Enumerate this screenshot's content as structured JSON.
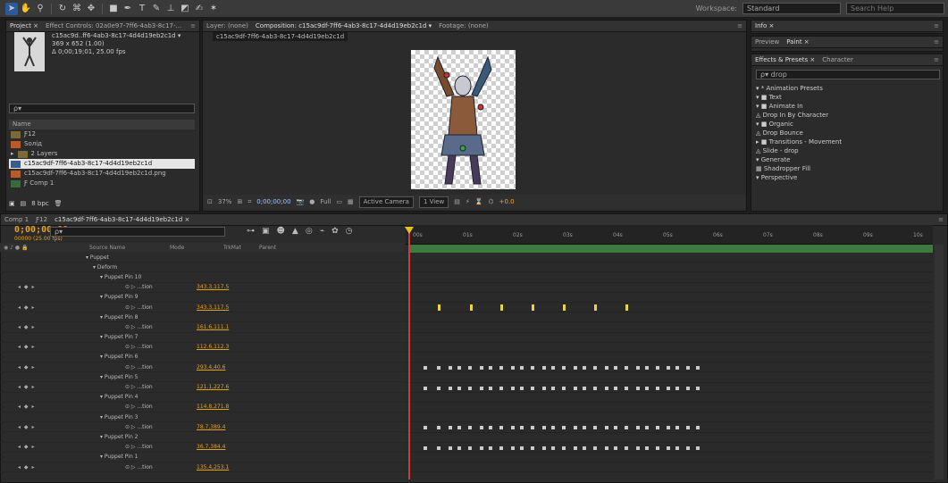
{
  "toolbar": {
    "tools": [
      "selection",
      "hand",
      "zoom",
      "rotate",
      "camera",
      "pan-behind",
      "mask",
      "pen",
      "text",
      "brush",
      "clone-stamp",
      "eraser",
      "roto-brush",
      "puppet-pin"
    ],
    "workspace_label": "Workspace:",
    "workspace_value": "Standard",
    "search_placeholder": "Search Help"
  },
  "project": {
    "tabs": [
      "Project ×",
      "Effect Controls: 02a0e97-7ff6-4ab3-8c17-..."
    ],
    "selected_name": "c15ac9d..ff6-4ab3-8c17-4d4d19eb2c1d ▾",
    "selected_size": "369 x 652 (1.00)",
    "selected_duration": "Δ 0;00;19;01, 25.00 fps",
    "search_placeholder": "ρ▾",
    "column_name": "Name",
    "items": [
      {
        "icon": "folder",
        "label": "Ƒ12"
      },
      {
        "icon": "comp",
        "label": "Ѕолід"
      },
      {
        "icon": "folder",
        "label": "2 Layers"
      },
      {
        "icon": "comp",
        "label": "c15ac9df-7ff6-4ab3-8c17-4d4d19eb2c1d",
        "selected": true
      },
      {
        "icon": "image",
        "label": "c15ac9df-7ff6-4ab3-8c17-4d4d19eb2c1d.png"
      },
      {
        "icon": "folder",
        "label": "Ƒ Comp 1"
      }
    ],
    "bpc": "8 bpc"
  },
  "viewer": {
    "tabs": [
      "Layer: (none)",
      "Composition: c15ac9df-7ff6-4ab3-8c17-4d4d19eb2c1d ▾",
      "Footage: (none)"
    ],
    "comp_name": "c15ac9df-7ff6-4ab3-8c17-4d4d19eb2c1d",
    "zoom": "37%",
    "timecode": "0;00;00;00",
    "resolution": "Full",
    "camera": "Active Camera",
    "views": "1 View",
    "exposure": "+0.0"
  },
  "info_panel": {
    "tabs": [
      "Info ×"
    ]
  },
  "preview_panel": {
    "tabs": [
      "Preview",
      "Paint ×"
    ]
  },
  "effects": {
    "tabs": [
      "Effects & Presets ×",
      "Character"
    ],
    "search_value": "drop",
    "tree": [
      "▾ * Animation Presets",
      "   ▾ ■ Text",
      "      ▾ ■ Animate In",
      "         ◬ Drop In By Character",
      "      ▾ ■ Organic",
      "         ◬ Drop Bounce",
      "   ▸ ■ Transitions - Movement",
      "         ◬ Slide - drop",
      "▾ Generate",
      "   ▦ Shadropper Fill",
      "▾ Perspective"
    ]
  },
  "timeline": {
    "tabs": [
      "Comp 1",
      "Ƒ12",
      "c15ac9df-7ff6-4ab3-8c17-4d4d19eb2c1d ×"
    ],
    "timecode": "0;00;00;00",
    "fps": "00000 (25.00 fps)",
    "search_placeholder": "ρ▾",
    "columns": {
      "name": "Source Name",
      "mode": "Mode",
      "trkmat": "TrkMat",
      "parent": "Parent"
    },
    "ruler": [
      "00s",
      "01s",
      "02s",
      "03s",
      "04s",
      "05s",
      "06s",
      "07s",
      "08s",
      "09s",
      "10s"
    ],
    "rows": [
      {
        "nav": "",
        "name": "▾ Puppet",
        "val": ""
      },
      {
        "nav": "",
        "name": "▾ Deform",
        "val": ""
      },
      {
        "nav": "",
        "name": "▾ Puppet Pin 10",
        "val": ""
      },
      {
        "nav": "◂ ◆ ▸",
        "name": "⊙ ▷ ...tion",
        "val": "343.3,117.5"
      },
      {
        "nav": "",
        "name": "▾ Puppet Pin 9",
        "val": ""
      },
      {
        "nav": "◂ ◆ ▸",
        "name": "⊙ ▷ ...tion",
        "val": "343.3,117.5"
      },
      {
        "nav": "",
        "name": "▾ Puppet Pin 8",
        "val": ""
      },
      {
        "nav": "◂ ◆ ▸",
        "name": "⊙ ▷ ...tion",
        "val": "161.6,111.1"
      },
      {
        "nav": "",
        "name": "▾ Puppet Pin 7",
        "val": ""
      },
      {
        "nav": "◂ ◆ ▸",
        "name": "⊙ ▷ ...tion",
        "val": "112.6,112.3"
      },
      {
        "nav": "",
        "name": "▾ Puppet Pin 6",
        "val": ""
      },
      {
        "nav": "◂ ◆ ▸",
        "name": "⊙ ▷ ...tion",
        "val": "293.4,40.6"
      },
      {
        "nav": "",
        "name": "▾ Puppet Pin 5",
        "val": ""
      },
      {
        "nav": "◂ ◆ ▸",
        "name": "⊙ ▷ ...tion",
        "val": "121.1,227.6"
      },
      {
        "nav": "",
        "name": "▾ Puppet Pin 4",
        "val": ""
      },
      {
        "nav": "◂ ◆ ▸",
        "name": "⊙ ▷ ...tion",
        "val": "114.8,271.8"
      },
      {
        "nav": "",
        "name": "▾ Puppet Pin 3",
        "val": ""
      },
      {
        "nav": "◂ ◆ ▸",
        "name": "⊙ ▷ ...tion",
        "val": "78.7,389.4"
      },
      {
        "nav": "",
        "name": "▾ Puppet Pin 2",
        "val": ""
      },
      {
        "nav": "◂ ◆ ▸",
        "name": "⊙ ▷ ...tion",
        "val": "36.7,384.4"
      },
      {
        "nav": "",
        "name": "▾ Puppet Pin 1",
        "val": ""
      },
      {
        "nav": "◂ ◆ ▸",
        "name": "⊙ ▷ ...tion",
        "val": "135.4,253.1"
      }
    ]
  },
  "colors": {
    "accent": "#e8a020",
    "cti": "#d23a3a",
    "workarea": "#3d7a3d",
    "keyframe_selected": "#e8d24a"
  }
}
